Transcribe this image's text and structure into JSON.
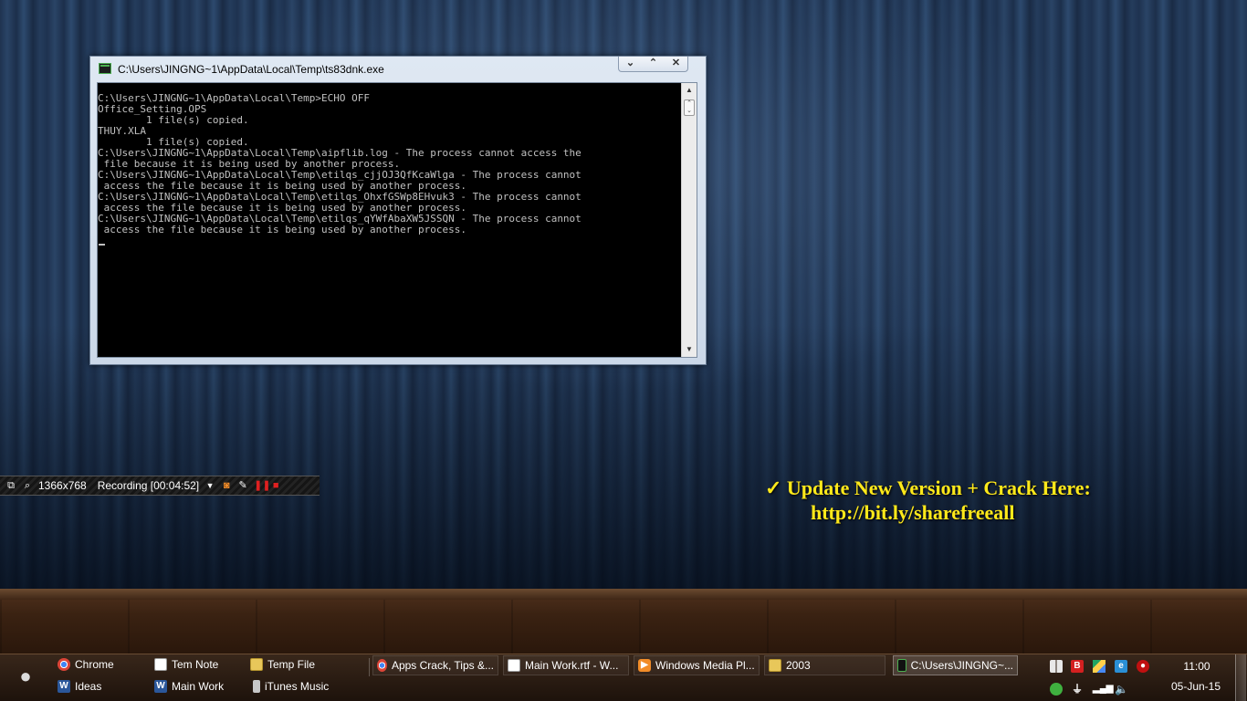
{
  "console_window": {
    "title": "C:\\Users\\JINGNG~1\\AppData\\Local\\Temp\\ts83dnk.exe",
    "minimize_glyph": "⌄",
    "maximize_glyph": "⌃",
    "close_glyph": "✕",
    "output": "C:\\Users\\JINGNG~1\\AppData\\Local\\Temp>ECHO OFF\nOffice_Setting.OPS\n        1 file(s) copied.\nTHUY.XLA\n        1 file(s) copied.\nC:\\Users\\JINGNG~1\\AppData\\Local\\Temp\\aipflib.log - The process cannot access the\n file because it is being used by another process.\nC:\\Users\\JINGNG~1\\AppData\\Local\\Temp\\etilqs_cjjOJ3QfKcaWlga - The process cannot\n access the file because it is being used by another process.\nC:\\Users\\JINGNG~1\\AppData\\Local\\Temp\\etilqs_OhxfGSWp8EHvuk3 - The process cannot\n access the file because it is being used by another process.\nC:\\Users\\JINGNG~1\\AppData\\Local\\Temp\\etilqs_qYWfAbaXW5JSSQN - The process cannot\n access the file because it is being used by another process."
  },
  "recording_bar": {
    "resolution": "1366x768",
    "status": "Recording [00:04:52]",
    "icons": [
      "window-icon",
      "magnifier-icon",
      "dropdown-icon",
      "camera-icon",
      "pen-icon",
      "pause-icon",
      "stop-icon"
    ]
  },
  "promo": {
    "line1": "✓ Update New Version + Crack Here:",
    "line2": "http://bit.ly/sharefreeall"
  },
  "taskbar": {
    "quick_launch": [
      {
        "label": "Chrome",
        "icon": "chrome-icon"
      },
      {
        "label": "Ideas",
        "icon": "word-icon"
      },
      {
        "label": "Tem Note",
        "icon": "document-icon"
      },
      {
        "label": "Main Work",
        "icon": "word-icon"
      },
      {
        "label": "Temp File",
        "icon": "folder-icon"
      },
      {
        "label": "iTunes Music",
        "icon": "ipod-icon"
      }
    ],
    "tasks": [
      {
        "label": "Apps Crack, Tips &...",
        "icon": "chrome-icon"
      },
      {
        "label": "Main Work.rtf - W...",
        "icon": "document-icon"
      },
      {
        "label": "Windows Media Pl...",
        "icon": "media-player-icon"
      },
      {
        "label": "2003",
        "icon": "folder-icon"
      },
      {
        "label": "C:\\Users\\JINGNG~...",
        "icon": "console-icon"
      }
    ],
    "tray": {
      "time": "11:00",
      "date": "05-Jun-15"
    }
  },
  "colors": {
    "promo_text": "#ffe91a",
    "console_bg": "#000000",
    "console_fg": "#c0c0c0"
  }
}
